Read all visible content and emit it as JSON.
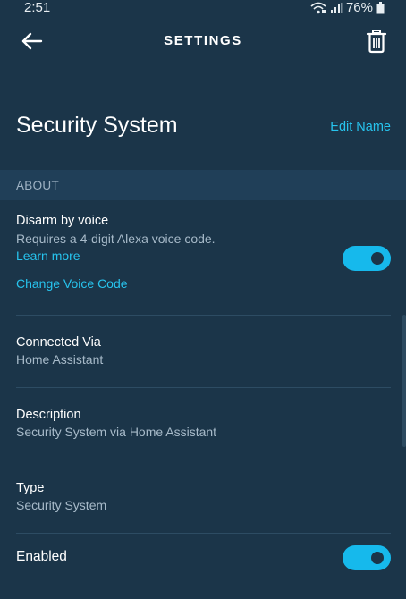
{
  "status_bar": {
    "time": "2:51",
    "battery": "76%"
  },
  "topbar": {
    "title": "SETTINGS"
  },
  "device": {
    "name": "Security System",
    "edit_label": "Edit Name"
  },
  "section": {
    "about_label": "ABOUT"
  },
  "disarm": {
    "title": "Disarm by voice",
    "subtitle": "Requires a 4-digit Alexa voice code.",
    "learn_more": "Learn more",
    "change_code": "Change Voice Code",
    "toggle_on": true
  },
  "connected_via": {
    "title": "Connected Via",
    "value": "Home Assistant"
  },
  "description": {
    "title": "Description",
    "value": "Security System via Home Assistant"
  },
  "type": {
    "title": "Type",
    "value": "Security System"
  },
  "enabled": {
    "title": "Enabled",
    "toggle_on": true
  },
  "colors": {
    "background": "#1b3549",
    "accent": "#27c4ee",
    "toggle": "#16b9ec",
    "section": "#203f58"
  },
  "icons": {
    "back": "arrow-left-icon",
    "delete": "trash-icon",
    "wifi": "wifi-icon",
    "signal": "signal-icon",
    "battery": "battery-icon"
  }
}
